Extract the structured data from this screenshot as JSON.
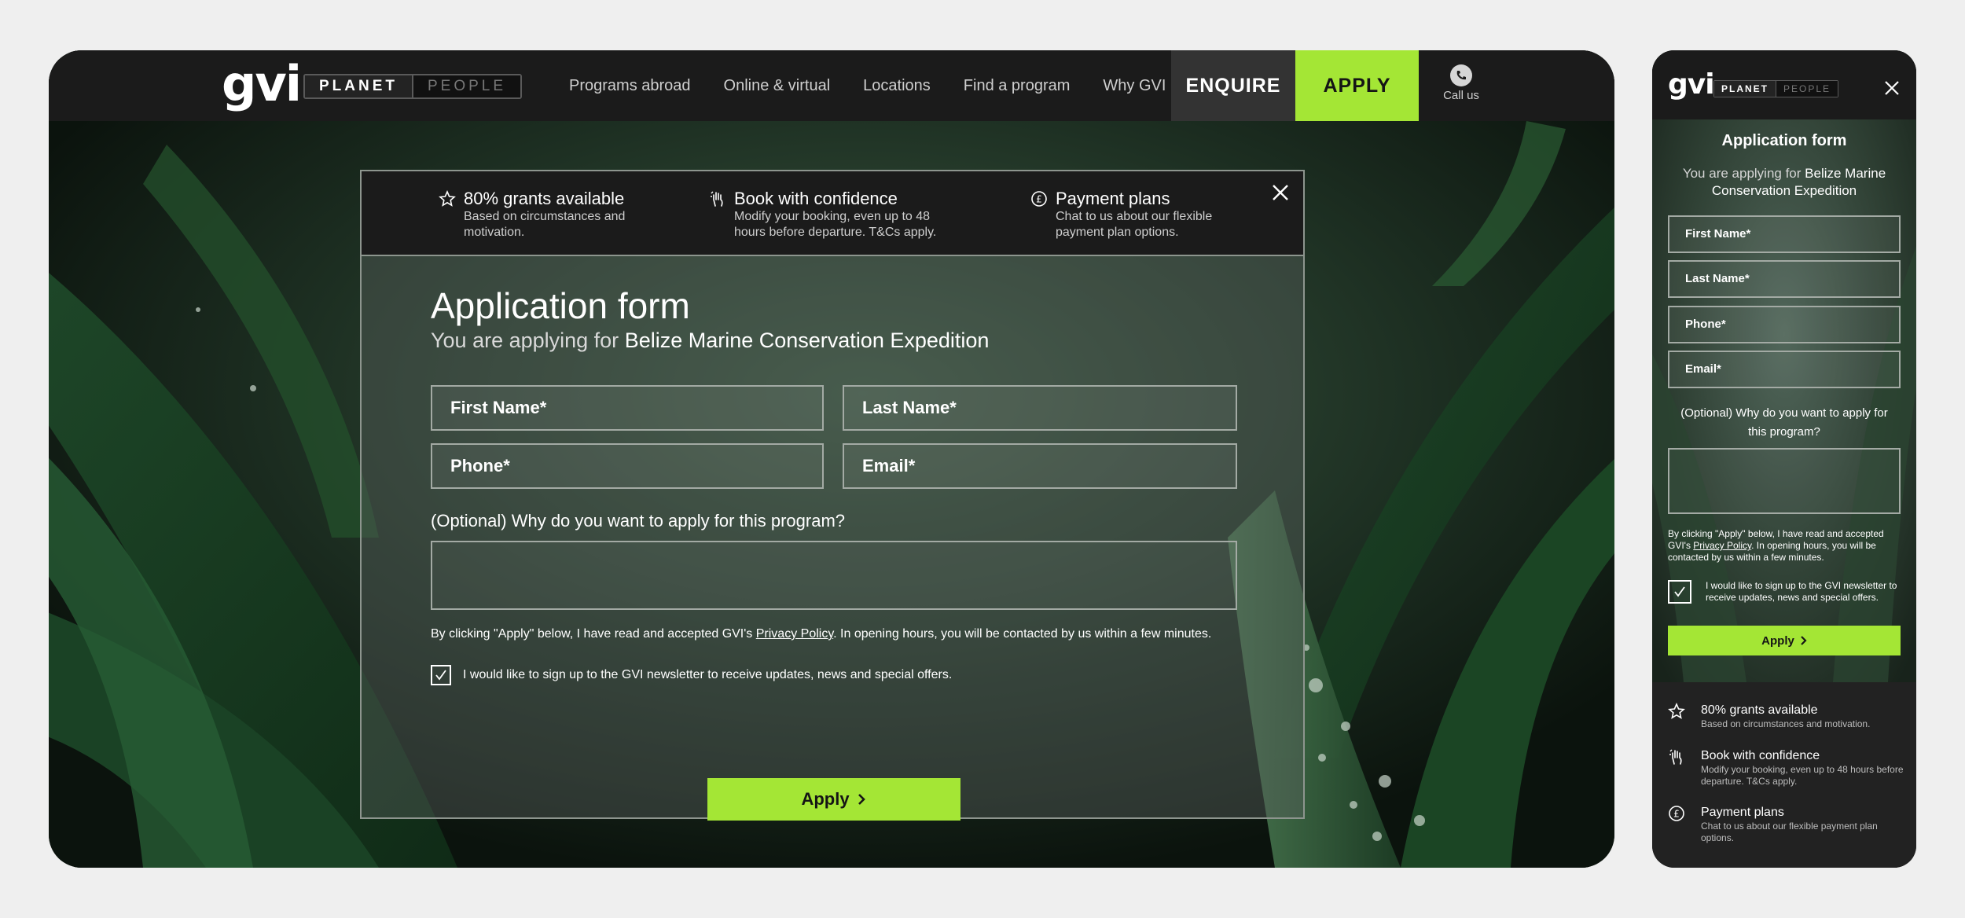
{
  "brand": {
    "logo": "gvi",
    "toggle_active": "PLANET",
    "toggle_inactive": "PEOPLE",
    "accent_color": "#a4e635"
  },
  "nav": {
    "links": [
      "Programs abroad",
      "Online & virtual",
      "Locations",
      "Find a program",
      "Why GVI"
    ],
    "enquire": "ENQUIRE",
    "apply": "APPLY",
    "call": "Call us",
    "call_icon": "phone-icon"
  },
  "benefits": [
    {
      "icon": "star-icon",
      "title": "80% grants available",
      "desc": "Based on circumstances and motivation."
    },
    {
      "icon": "hand-icon",
      "title": "Book with confidence",
      "desc": "Modify your booking, even up to 48 hours before departure. T&Cs apply."
    },
    {
      "icon": "pound-icon",
      "title": "Payment plans",
      "desc": "Chat to us about our flexible payment plan options."
    }
  ],
  "form": {
    "title": "Application form",
    "sub_prefix": "You are applying for ",
    "program": "Belize Marine Conservation Expedition",
    "first_name": "First Name*",
    "last_name": "Last Name*",
    "phone": "Phone*",
    "email": "Email*",
    "question": "(Optional) Why do you want to apply for this program?",
    "consent_pre": "By clicking \"Apply\" below, I have read and accepted GVI's ",
    "privacy": "Privacy Policy",
    "consent_post": ". In opening hours, you will be contacted by us within a few minutes.",
    "newsletter": "I would like to sign up to the GVI newsletter to receive updates, news and special offers.",
    "newsletter_checked": true,
    "apply": "Apply"
  }
}
